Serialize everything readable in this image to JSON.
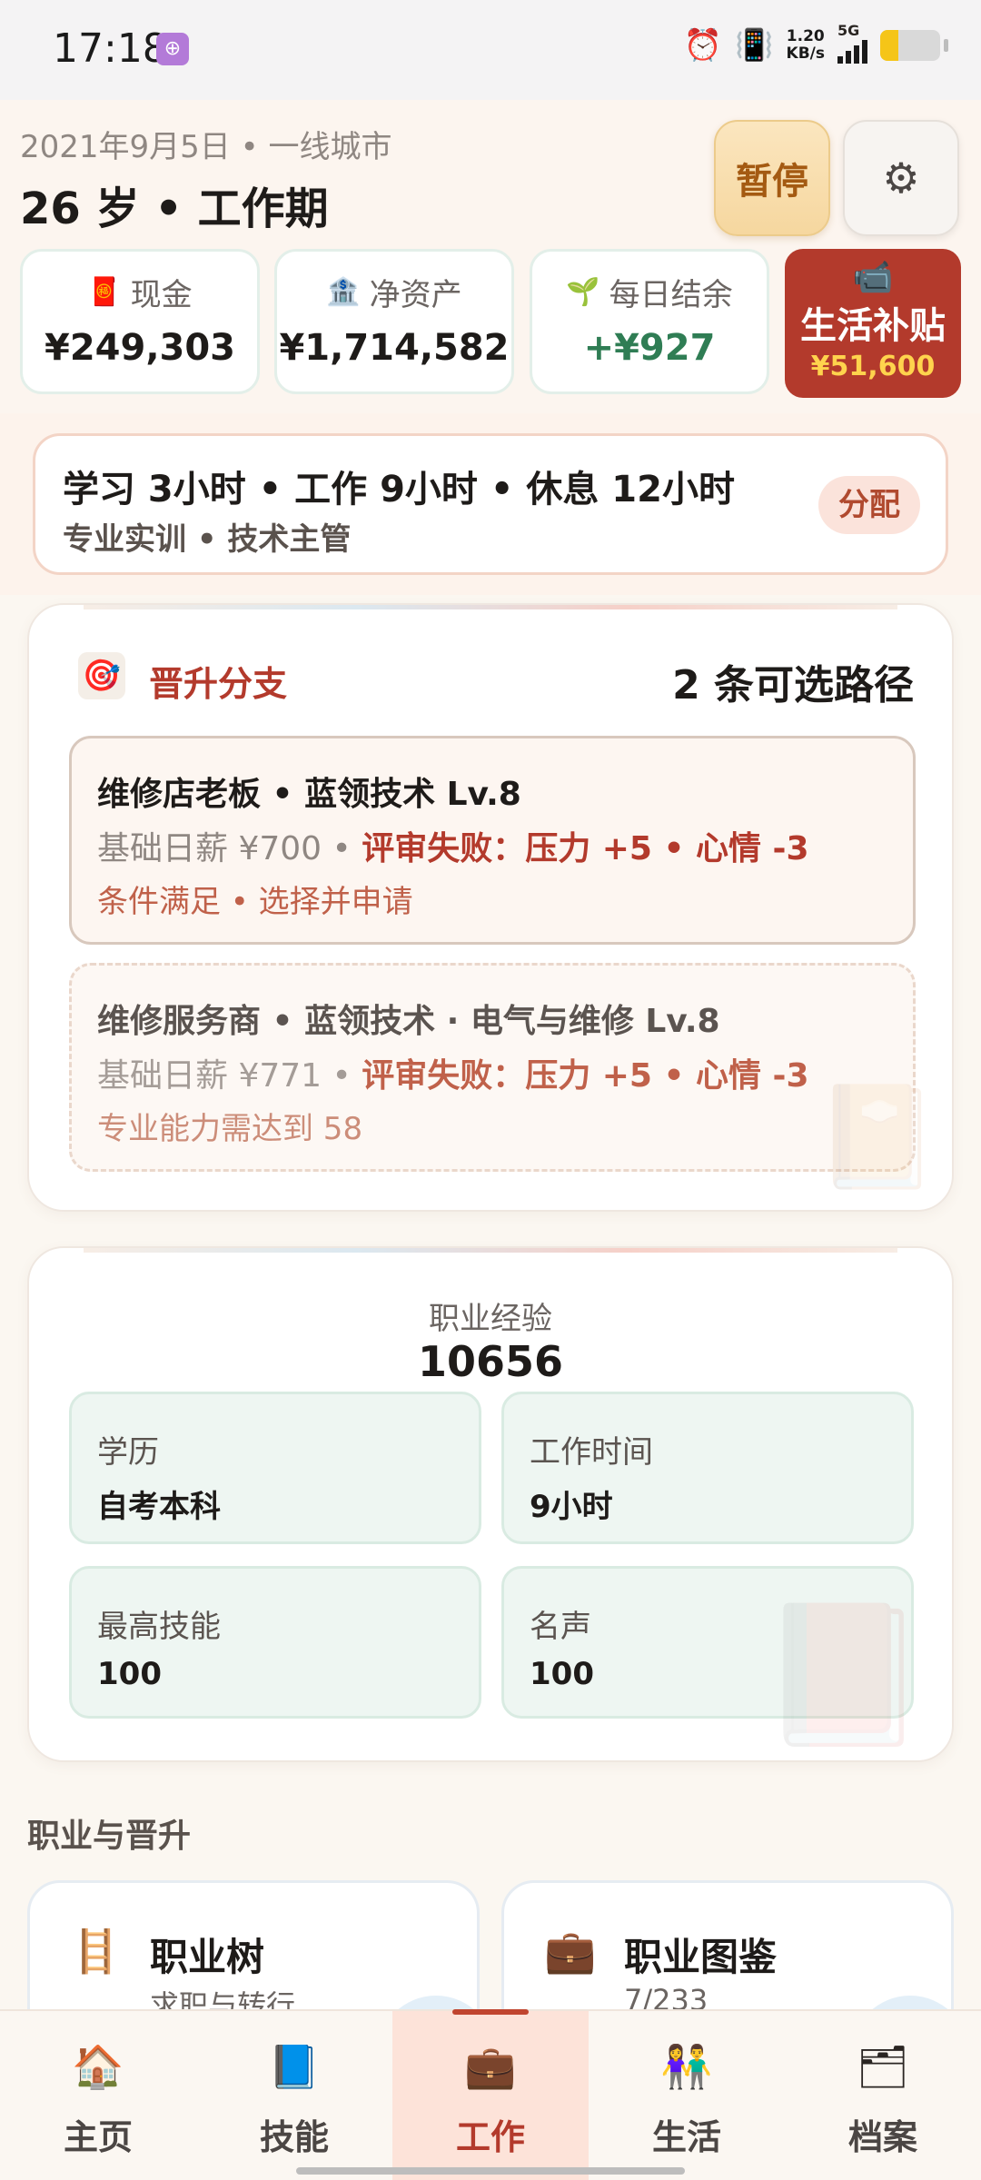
{
  "status_bar": {
    "time": "17:18",
    "app_badge": "⊕",
    "net_speed_value": "1.20",
    "net_speed_unit": "KB/s",
    "network": "5G",
    "battery_level": 0.3,
    "icons": [
      "alarm-icon",
      "vibrate-icon",
      "signal-icon",
      "battery-icon"
    ]
  },
  "header": {
    "date_line": "2021年9月5日 • 一线城市",
    "age_line": "26 岁 • 工作期",
    "pause_label": "暂停",
    "settings_icon": "gear-icon"
  },
  "stats": {
    "cash": {
      "label": "现金",
      "value": "¥249,303",
      "icon": "red-envelope-icon"
    },
    "net_assets": {
      "label": "净资产",
      "value": "¥1,714,582",
      "icon": "bank-icon"
    },
    "daily_balance": {
      "label": "每日结余",
      "value": "+¥927",
      "icon": "sprout-icon"
    },
    "subsidy": {
      "label": "生活补贴",
      "value": "¥51,600",
      "icon": "video-camera-icon"
    }
  },
  "schedule": {
    "main": "学习 3小时 • 工作 9小时 • 休息 12小时",
    "sub": "专业实训 • 技术主管",
    "button": "分配"
  },
  "promotion": {
    "title": "晋升分支",
    "count": "2 条可选路径",
    "branches": [
      {
        "title": "维修店老板 • 蓝领技术 Lv.8",
        "salary": "基础日薪 ¥700 • ",
        "failure": "评审失败：压力 +5 • 心情 -3",
        "note": "条件满足 • 选择并申请"
      },
      {
        "title": "维修服务商 • 蓝领技术 · 电气与维修 Lv.8",
        "salary": "基础日薪 ¥771 • ",
        "failure": "评审失败：压力 +5 • 心情 -3",
        "note": "专业能力需达到 58"
      }
    ]
  },
  "experience": {
    "label": "职业经验",
    "value": "10656",
    "items": [
      {
        "k": "学历",
        "v": "自考本科"
      },
      {
        "k": "工作时间",
        "v": "9小时"
      },
      {
        "k": "最高技能",
        "v": "100"
      },
      {
        "k": "名声",
        "v": "100"
      }
    ]
  },
  "career_section": {
    "title": "职业与晋升",
    "tiles": [
      {
        "title": "职业树",
        "subtitle": "求职与转行",
        "icon": "ladder-icon"
      },
      {
        "title": "职业图鉴",
        "subtitle": "7/233",
        "icon": "briefcase-book-icon"
      }
    ]
  },
  "bottom_nav": {
    "items": [
      {
        "label": "主页",
        "icon": "house-icon"
      },
      {
        "label": "技能",
        "icon": "skill-book-icon"
      },
      {
        "label": "工作",
        "icon": "briefcase-icon"
      },
      {
        "label": "生活",
        "icon": "people-icon"
      },
      {
        "label": "档案",
        "icon": "archive-icon"
      }
    ],
    "active": "工作"
  }
}
